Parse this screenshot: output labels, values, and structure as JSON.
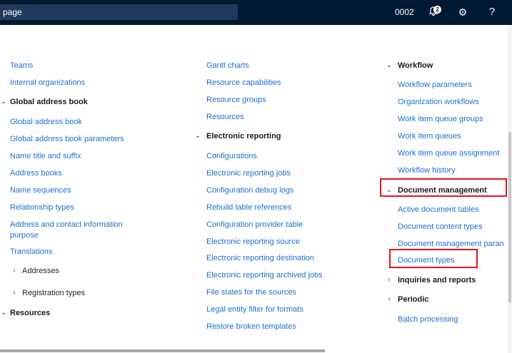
{
  "topbar": {
    "search_text": "page",
    "company": "0002",
    "notification_count": "2"
  },
  "col1": {
    "links_top": [
      "Teams",
      "Internal organizations"
    ],
    "group1_header": "Global address book",
    "group1_links": [
      "Global address book",
      "Global address book parameters",
      "Name title and suffix",
      "Address books",
      "Name sequences",
      "Relationship types",
      "Address and contact information",
      "purpose",
      "Translations"
    ],
    "sub1": "Addresses",
    "sub2": "Registration types",
    "group2_header": "Resources"
  },
  "col2": {
    "links_top": [
      "Gantt charts",
      "Resource capabilities",
      "Resource groups",
      "Resources"
    ],
    "group_header": "Electronic reporting",
    "group_links": [
      "Configurations",
      "Electronic reporting jobs",
      "Configuration debug logs",
      "Rebuild table references",
      "Configuration provider table",
      "Electronic reporting source",
      "Electronic reporting destination",
      "Electronic reporting archived jobs",
      "File states for the sources",
      "Legal entity filter for formats",
      "Restore broken templates"
    ]
  },
  "col3": {
    "workflow_header": "Workflow",
    "workflow_links": [
      "Workflow parameters",
      "Organization workflows",
      "Work item queue groups",
      "Work item queues",
      "Work item queue assignment",
      "Workflow history"
    ],
    "docmgmt_header": "Document management",
    "docmgmt_links": [
      "Active document tables",
      "Document content types",
      "Document management paran",
      "Document types"
    ],
    "inquiries_header": "Inquiries and reports",
    "periodic_header": "Periodic",
    "periodic_links": [
      "Batch processing"
    ]
  }
}
